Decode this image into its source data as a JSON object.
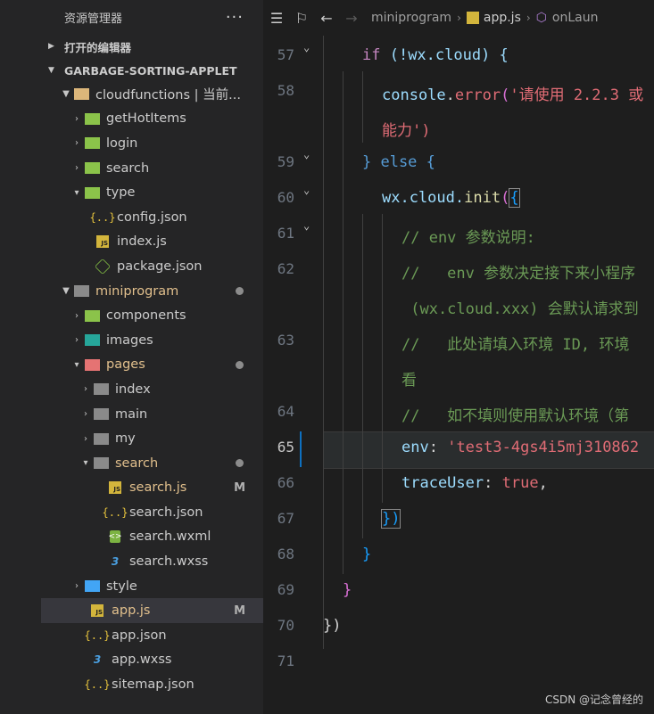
{
  "explorer": {
    "title": "资源管理器",
    "more": "···",
    "open_editors": "打开的编辑器",
    "project": "GARBAGE-SORTING-APPLET",
    "items": [
      {
        "label": "cloudfunctions | 当前...",
        "badge": ""
      },
      {
        "label": "getHotItems",
        "badge": ""
      },
      {
        "label": "login",
        "badge": ""
      },
      {
        "label": "search",
        "badge": ""
      },
      {
        "label": "type",
        "badge": ""
      },
      {
        "label": "config.json",
        "badge": ""
      },
      {
        "label": "index.js",
        "badge": ""
      },
      {
        "label": "package.json",
        "badge": ""
      },
      {
        "label": "miniprogram",
        "badge": ""
      },
      {
        "label": "components",
        "badge": ""
      },
      {
        "label": "images",
        "badge": ""
      },
      {
        "label": "pages",
        "badge": ""
      },
      {
        "label": "index",
        "badge": ""
      },
      {
        "label": "main",
        "badge": ""
      },
      {
        "label": "my",
        "badge": ""
      },
      {
        "label": "search",
        "badge": ""
      },
      {
        "label": "search.js",
        "badge": "M"
      },
      {
        "label": "search.json",
        "badge": ""
      },
      {
        "label": "search.wxml",
        "badge": ""
      },
      {
        "label": "search.wxss",
        "badge": ""
      },
      {
        "label": "style",
        "badge": ""
      },
      {
        "label": "app.js",
        "badge": "M"
      },
      {
        "label": "app.json",
        "badge": ""
      },
      {
        "label": "app.wxss",
        "badge": ""
      },
      {
        "label": "sitemap.json",
        "badge": ""
      }
    ]
  },
  "breadcrumb": {
    "folder": "miniprogram",
    "file": "app.js",
    "symbol": "onLaun"
  },
  "editor": {
    "line_numbers": [
      "57",
      "58",
      "59",
      "60",
      "61",
      "62",
      "63",
      "64",
      "65",
      "66",
      "67",
      "68",
      "69",
      "70",
      "71"
    ],
    "lines": {
      "l57_kw": "if",
      "l57_rest": " (!wx.cloud) {",
      "l58_obj": "console",
      "l58_fn": "error",
      "l58_str": "'请使用 2.2.3 或",
      "l58b": "能力')",
      "l59": "} else {",
      "l60_obj": "wx.cloud.",
      "l60_fn": "init",
      "l61": "// env 参数说明:",
      "l62": "//   env 参数决定接下来小程序",
      "l62b": " (wx.cloud.xxx) 会默认请求到",
      "l63": "//   此处请填入环境 ID, 环境",
      "l63b": "看",
      "l64": "//   如不填则使用默认环境（第",
      "l65_key": "env",
      "l65_str": "'test3-4gs4i5mj310862",
      "l66_key": "traceUser",
      "l66_val": "true",
      "l67": "})",
      "l68": "}",
      "l69": "}",
      "l70": "})"
    }
  },
  "watermark": "CSDN @记念曾经的"
}
